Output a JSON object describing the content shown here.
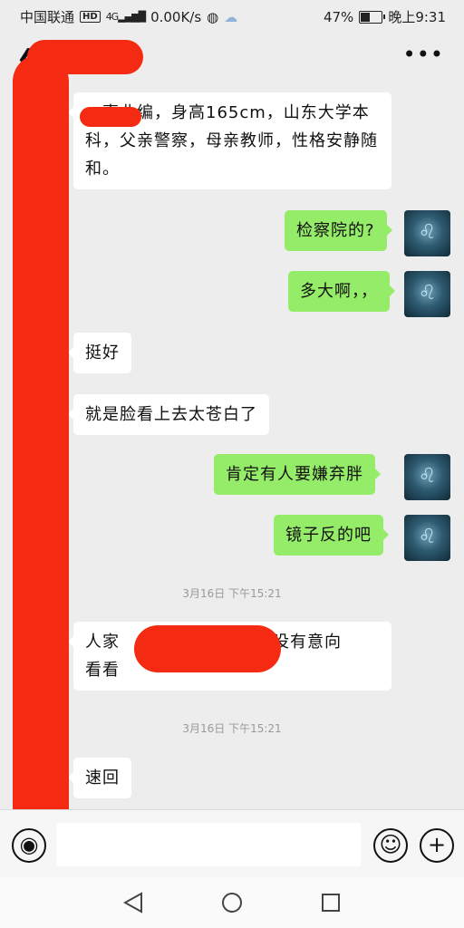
{
  "status_bar": {
    "carrier": "中国联通",
    "network_badge": "HD",
    "signal_text": "4G",
    "net_speed": "0.00K/s",
    "battery_percent": "47%",
    "battery_level": 0.47,
    "time": "晚上9:31"
  },
  "title_bar": {
    "back_icon": "chevron-left-icon",
    "more_label": "•••"
  },
  "messages": [
    {
      "side": "left",
      "text": "，事业编，身高165cm，山东大学本科，父亲警察，母亲教师，性格安静随和。"
    },
    {
      "side": "right",
      "text": "检察院的?"
    },
    {
      "side": "right",
      "text": "多大啊，，"
    },
    {
      "side": "left",
      "text": "挺好"
    },
    {
      "side": "left",
      "text": "就是脸看上去太苍白了"
    },
    {
      "side": "right",
      "text": "肯定有人要嫌弃胖"
    },
    {
      "side": "right",
      "text": "镜子反的吧"
    },
    {
      "side": "time",
      "text": "3月16日 下午15:21"
    },
    {
      "side": "left",
      "text": "人家",
      "text_tail": "有没有意向",
      "text_line2": "看看"
    },
    {
      "side": "time",
      "text": "3月16日 下午15:21"
    },
    {
      "side": "left",
      "text": "速回"
    }
  ],
  "input_bar": {
    "voice_icon": "voice-icon",
    "emoji_icon": "emoji-icon",
    "plus_icon": "plus-icon"
  },
  "nav_bar": {
    "back_icon": "triangle-back-icon",
    "home_icon": "circle-home-icon",
    "recent_icon": "square-recent-icon"
  },
  "colors": {
    "background": "#ededed",
    "bubble_sent": "#95ec69",
    "bubble_received": "#ffffff",
    "redaction": "#f52a12"
  }
}
